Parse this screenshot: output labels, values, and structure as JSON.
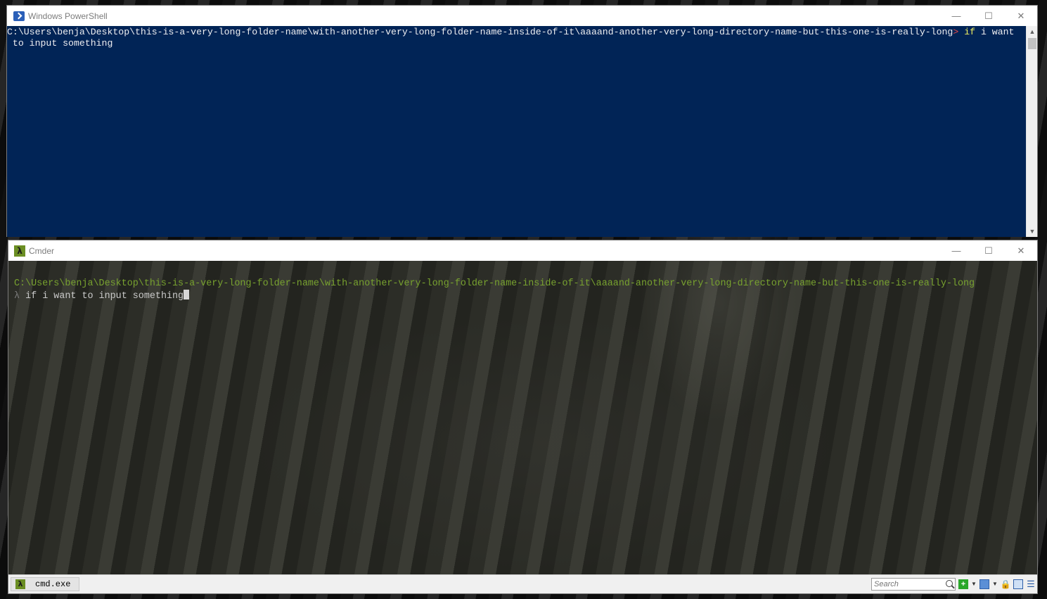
{
  "powershell": {
    "title": "Windows PowerShell",
    "prompt_path": "C:\\Users\\benja\\Desktop\\this-is-a-very-long-folder-name\\with-another-very-long-folder-name-inside-of-it\\aaaand-another-very-long-directory-name-but-this-one-is-really-long",
    "prompt_arrow": ">",
    "cmd_keyword": "if",
    "cmd_line1_rest": "i want",
    "cmd_line2": "to input something",
    "controls": {
      "minimize": "—",
      "maximize": "☐",
      "close": "✕"
    },
    "scroll_up": "▲",
    "scroll_down": "▼"
  },
  "cmder": {
    "title": "Cmder",
    "prompt_path": "C:\\Users\\benja\\Desktop\\this-is-a-very-long-folder-name\\with-another-very-long-folder-name-inside-of-it\\aaaand-another-very-long-directory-name-but-this-one-is-really-long",
    "prompt_symbol": "λ",
    "input_text": "if i want to input something",
    "controls": {
      "minimize": "—",
      "maximize": "☐",
      "close": "✕"
    },
    "tab_label": "cmd.exe",
    "tab_icon": "λ",
    "search_placeholder": "Search",
    "toolbar_icons": [
      "new-console-icon",
      "caret-down-icon",
      "console-list-icon",
      "caret-down-icon",
      "lock-icon",
      "split-view-icon",
      "menu-icon"
    ]
  },
  "colors": {
    "powershell_bg": "#012456",
    "cmder_path": "#78a22f",
    "cmder_bg": "#2b2c26"
  }
}
